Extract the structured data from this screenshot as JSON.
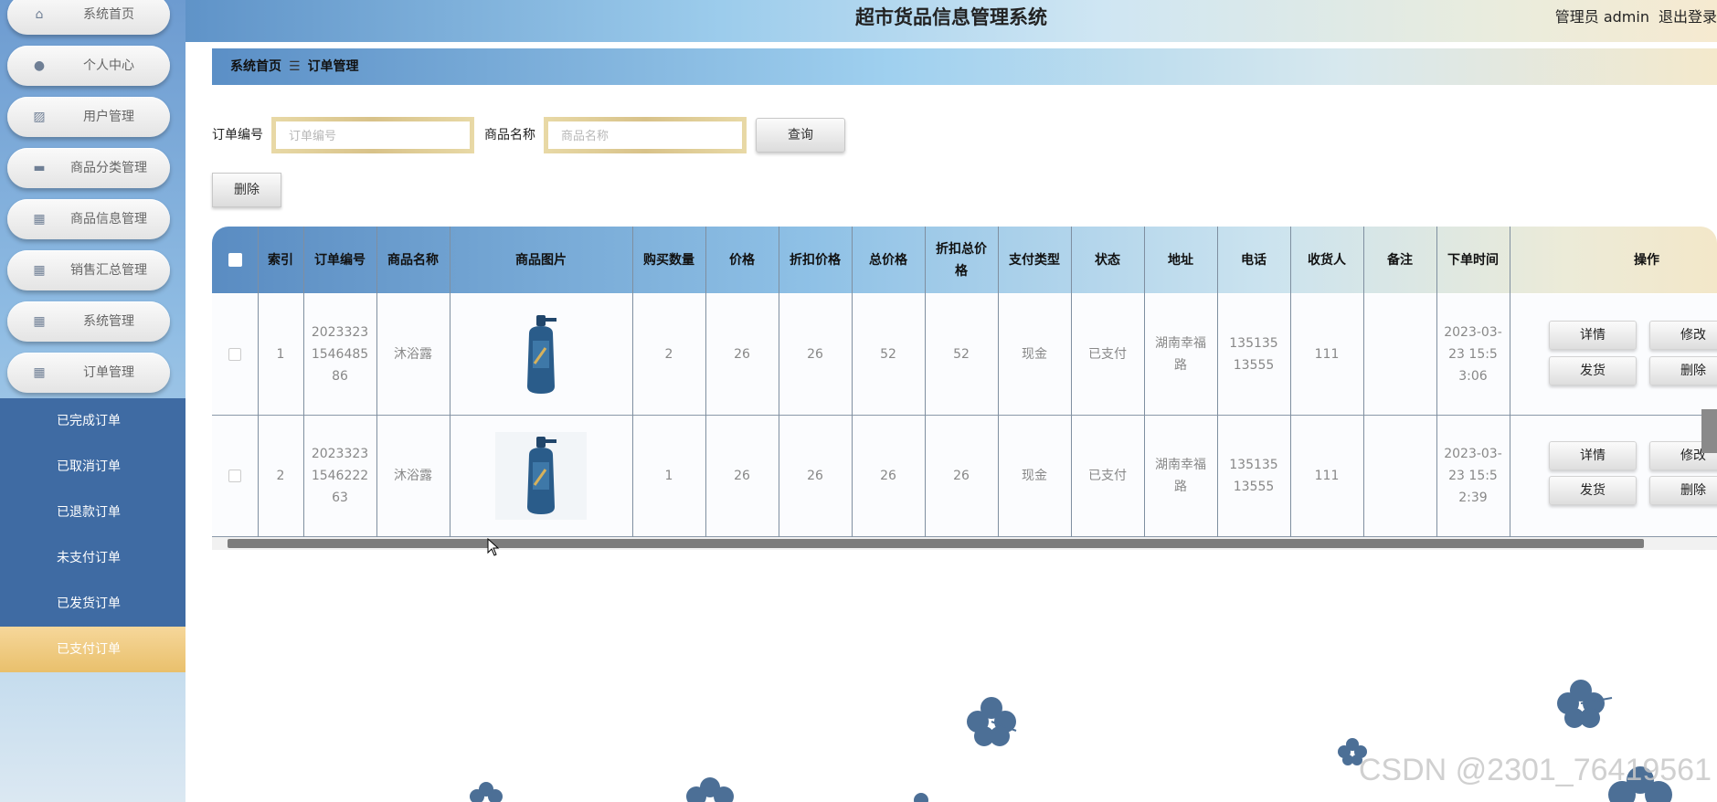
{
  "app": {
    "title": "超市货品信息管理系统",
    "user": "管理员 admin",
    "logout": "退出登录"
  },
  "sidebar": {
    "items": [
      {
        "label": "系统首页",
        "icon": "home-icon"
      },
      {
        "label": "个人中心",
        "icon": "user-icon"
      },
      {
        "label": "用户管理",
        "icon": "chart-icon"
      },
      {
        "label": "商品分类管理",
        "icon": "monitor-icon"
      },
      {
        "label": "商品信息管理",
        "icon": "grid-icon"
      },
      {
        "label": "销售汇总管理",
        "icon": "grid-icon"
      },
      {
        "label": "系统管理",
        "icon": "grid-icon"
      },
      {
        "label": "订单管理",
        "icon": "grid-icon"
      }
    ],
    "submenu": [
      {
        "label": "已完成订单"
      },
      {
        "label": "已取消订单"
      },
      {
        "label": "已退款订单"
      },
      {
        "label": "未支付订单"
      },
      {
        "label": "已发货订单"
      },
      {
        "label": "已支付订单",
        "active": true
      }
    ]
  },
  "breadcrumb": {
    "home": "系统首页",
    "separator": "☰",
    "current": "订单管理"
  },
  "search": {
    "order_no_label": "订单编号",
    "order_no_placeholder": "订单编号",
    "product_label": "商品名称",
    "product_placeholder": "商品名称",
    "query_button": "查询",
    "delete_button": "删除"
  },
  "table": {
    "columns": [
      "索引",
      "订单编号",
      "商品名称",
      "商品图片",
      "购买数量",
      "价格",
      "折扣价格",
      "总价格",
      "折扣总价格",
      "支付类型",
      "状态",
      "地址",
      "电话",
      "收货人",
      "备注",
      "下单时间",
      "操作"
    ],
    "rows": [
      {
        "index": "1",
        "order_no": "20233231546485 86",
        "product": "沐浴露",
        "qty": "2",
        "price": "26",
        "discount_price": "26",
        "total": "52",
        "discount_total": "52",
        "pay_type": "现金",
        "status": "已支付",
        "address": "湖南幸福路",
        "phone": "13513513555",
        "receiver": "111",
        "note": "",
        "time": "2023-03-23 15:53:06"
      },
      {
        "index": "2",
        "order_no": "20233231546222 63",
        "product": "沐浴露",
        "qty": "1",
        "price": "26",
        "discount_price": "26",
        "total": "26",
        "discount_total": "26",
        "pay_type": "现金",
        "status": "已支付",
        "address": "湖南幸福路",
        "phone": "13513513555",
        "receiver": "111",
        "note": "",
        "time": "2023-03-23 15:52:39"
      }
    ],
    "actions": {
      "detail": "详情",
      "edit": "修改",
      "ship": "发货",
      "delete": "删除"
    }
  },
  "watermark": "CSDN @2301_76419561",
  "colors": {
    "accent": "#3f6ba3",
    "active": "#e9c06c",
    "flower": "#4c6f96"
  }
}
